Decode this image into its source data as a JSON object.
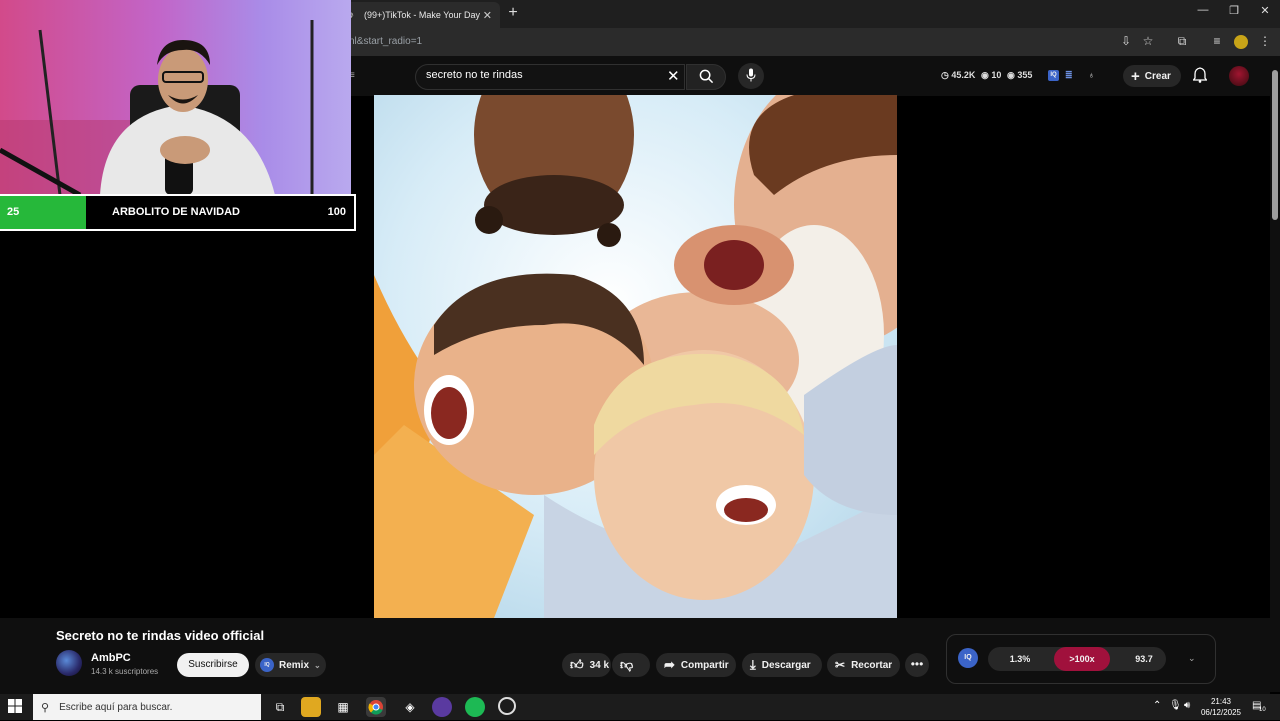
{
  "browser": {
    "tab_title": "(99+)TikTok - Make Your Day",
    "url_fragment": "nl&start_radio=1"
  },
  "search": {
    "query": "secreto no te rindas"
  },
  "header_stats": {
    "views": "45.2K",
    "eye_count": "10",
    "count3": "355",
    "iq_label": "IQ"
  },
  "create_label": "Crear",
  "overlay": {
    "left_value": "25",
    "title": "ARBOLITO DE NAVIDAD",
    "right_value": "100",
    "progress": 0.25
  },
  "video": {
    "title": "Secreto no te rindas video official",
    "channel": "AmbPC",
    "subscribers": "14.3 k suscriptores",
    "subscribe_label": "Suscribirse",
    "remix_label": "Remix",
    "likes": "34 k",
    "share_label": "Compartir",
    "download_label": "Descargar",
    "clip_label": "Recortar"
  },
  "iq_panel": {
    "logo": "IQ",
    "v1": "1.3%",
    "v2": ">100x",
    "v3": "93.7"
  },
  "taskbar": {
    "search_placeholder": "Escribe aquí para buscar.",
    "time": "21:43",
    "date": "06/12/2025",
    "notif_count": "10"
  },
  "colors": {
    "progress_green": "#26b83a",
    "iq_blue": "#3b64c8",
    "iq_red": "#a0113c"
  }
}
